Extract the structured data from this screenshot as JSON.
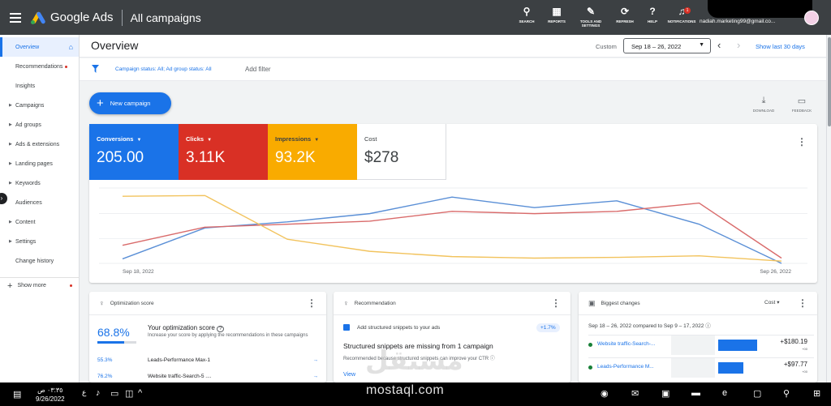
{
  "topbar": {
    "brand": "Google Ads",
    "page": "All campaigns",
    "tools": [
      {
        "icon": "search-icon",
        "glyph": "⚲",
        "label": "SEARCH"
      },
      {
        "icon": "reports-icon",
        "glyph": "▦",
        "label": "REPORTS"
      },
      {
        "icon": "wrench-icon",
        "glyph": "🔧",
        "label": "TOOLS AND SETTINGS"
      },
      {
        "icon": "refresh-icon",
        "glyph": "⟳",
        "label": "REFRESH"
      },
      {
        "icon": "help-icon",
        "glyph": "?",
        "label": "HELP"
      },
      {
        "icon": "bell-icon",
        "glyph": "🔔",
        "label": "NOTIFICATIONS",
        "badge": "1"
      }
    ],
    "account_email": "nadiah.marketing99@gmail.co..."
  },
  "sidebar": {
    "items": [
      {
        "label": "Overview",
        "active": true,
        "arrow": false
      },
      {
        "label": "Recommendations",
        "dot": true,
        "arrow": false
      },
      {
        "label": "Insights",
        "arrow": false
      },
      {
        "label": "Campaigns",
        "arrow": true
      },
      {
        "label": "Ad groups",
        "arrow": true
      },
      {
        "label": "Ads & extensions",
        "arrow": true
      },
      {
        "label": "Landing pages",
        "arrow": true
      },
      {
        "label": "Keywords",
        "arrow": true
      },
      {
        "label": "Audiences",
        "arrow": false
      },
      {
        "label": "Content",
        "arrow": true
      },
      {
        "label": "Settings",
        "arrow": true
      },
      {
        "label": "Change history",
        "arrow": false
      }
    ],
    "show_more": "Show more"
  },
  "overview": {
    "title": "Overview",
    "custom_label": "Custom",
    "date_range": "Sep 18 – 26, 2022",
    "show_last": "Show last 30 days"
  },
  "filters": {
    "status_text": "Campaign status: All; Ad group status: All",
    "add_filter": "Add filter"
  },
  "actions": {
    "new_campaign": "New campaign",
    "download": "DOWNLOAD",
    "feedback": "FEEDBACK"
  },
  "metrics": [
    {
      "label": "Conversions",
      "value": "205.00",
      "color": "#1a73e8",
      "dropdown": true
    },
    {
      "label": "Clicks",
      "value": "3.11K",
      "color": "#d93025",
      "dropdown": true
    },
    {
      "label": "Impressions",
      "value": "93.2K",
      "color": "#f9ab00",
      "dropdown": true
    },
    {
      "label": "Cost",
      "value": "$278",
      "color": "#ffffff",
      "dropdown": false
    }
  ],
  "chart_data": {
    "type": "line",
    "x": [
      "Sep 18, 2022",
      "Sep 19, 2022",
      "Sep 20, 2022",
      "Sep 21, 2022",
      "Sep 22, 2022",
      "Sep 23, 2022",
      "Sep 24, 2022",
      "Sep 25, 2022",
      "Sep 26, 2022"
    ],
    "x_tick_labels": [
      "Sep 18, 2022",
      "Sep 26, 2022"
    ],
    "ylim": [
      0,
      1
    ],
    "series": [
      {
        "name": "Conversions",
        "color": "#5a8fd6",
        "values": [
          0.06,
          0.47,
          0.55,
          0.66,
          0.88,
          0.74,
          0.83,
          0.52,
          0.0
        ]
      },
      {
        "name": "Clicks",
        "color": "#d96b6b",
        "values": [
          0.24,
          0.48,
          0.52,
          0.56,
          0.69,
          0.66,
          0.69,
          0.8,
          0.07
        ]
      },
      {
        "name": "Impressions",
        "color": "#f2c35d",
        "values": [
          0.89,
          0.9,
          0.32,
          0.16,
          0.09,
          0.07,
          0.08,
          0.1,
          0.03
        ]
      }
    ],
    "grid": true
  },
  "opt_card": {
    "title": "Optimization score",
    "score": "68.8%",
    "score_fraction": 0.688,
    "heading": "Your optimization score",
    "desc": "Increase your score by applying the recommendations in these campaigns",
    "rows": [
      {
        "pct": "55.3%",
        "name": "Leads-Performance Max-1"
      },
      {
        "pct": "76.2%",
        "name": "Website traffic-Search-5 ...."
      }
    ]
  },
  "rec_card": {
    "title": "Recommendation",
    "item": "Add structured snippets to your ads",
    "uplift": "+1.7%",
    "heading": "Structured snippets are missing from 1 campaign",
    "desc": "Recommended because structured snippets can improve your CTR",
    "view": "View"
  },
  "bc_card": {
    "title": "Biggest changes",
    "select": "Cost",
    "subtitle": "Sep 18 – 26, 2022 compared to Sep 9 – 17, 2022",
    "rows": [
      {
        "name": "Website traffic-Search-...",
        "amount": "+$180.19",
        "sub": "+00",
        "bar_fraction": 0.5
      },
      {
        "name": "Leads-Performance M...",
        "amount": "+$97.77",
        "sub": "+00",
        "bar_fraction": 0.32
      }
    ]
  },
  "taskbar": {
    "time": "٠٣:٣٥ ص",
    "date": "9/26/2022",
    "lang": "ع"
  },
  "watermark": {
    "arabic": "مستقل",
    "latin": "mostaql.com"
  }
}
